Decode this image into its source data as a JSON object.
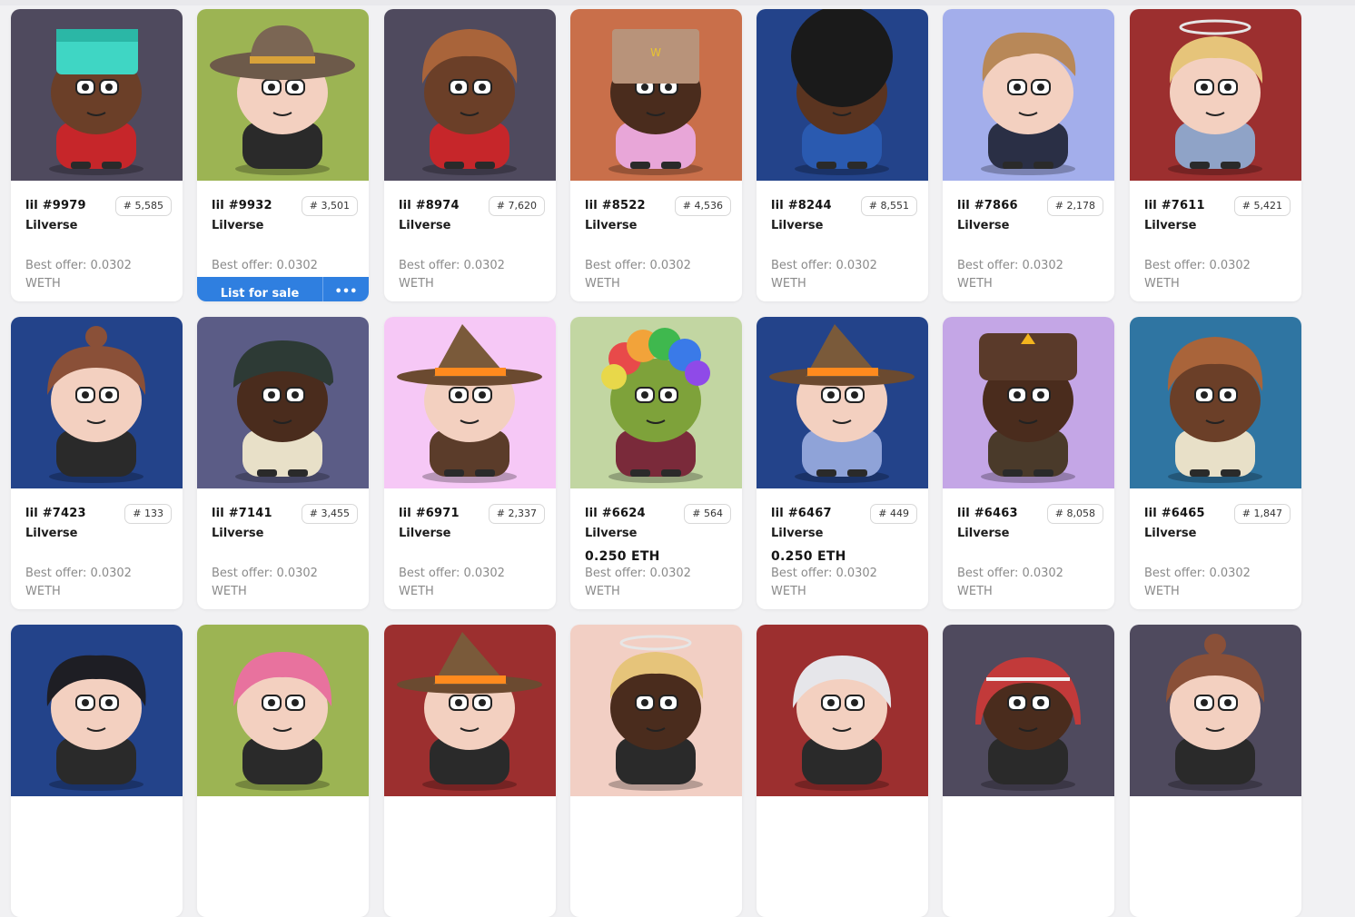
{
  "collection": "Lilverse",
  "offer_text": "Best offer: 0.0302",
  "currency": "WETH",
  "rank_prefix": "#",
  "actions": {
    "list_label": "List for sale",
    "more_label": "•••"
  },
  "cards": [
    {
      "name": "lil #9979",
      "rank": "5,585",
      "bg": "#4f4a5e",
      "skin": "#6b3f28",
      "shirt": "#c6262a",
      "hat": "helmet",
      "price": ""
    },
    {
      "name": "lil #9932",
      "rank": "3,501",
      "bg": "#9cb453",
      "skin": "#f3d0c0",
      "shirt": "#2a2a2a",
      "hat": "sombrero",
      "price": ""
    },
    {
      "name": "lil #8974",
      "rank": "7,620",
      "bg": "#4f4a5e",
      "skin": "#6b3f28",
      "shirt": "#c6262a",
      "hat": "hair-brown",
      "price": ""
    },
    {
      "name": "lil #8522",
      "rank": "4,536",
      "bg": "#c96f4a",
      "skin": "#4a2c1d",
      "shirt": "#e8a6d8",
      "hat": "bag",
      "price": ""
    },
    {
      "name": "lil #8244",
      "rank": "8,551",
      "bg": "#23438a",
      "skin": "#5a3420",
      "shirt": "#2a5ab0",
      "hat": "afro",
      "price": ""
    },
    {
      "name": "lil #7866",
      "rank": "2,178",
      "bg": "#a3aeeb",
      "skin": "#f3d0c0",
      "shirt": "#2a2f45",
      "hat": "hair-light",
      "price": ""
    },
    {
      "name": "lil #7611",
      "rank": "5,421",
      "bg": "#9c2f2f",
      "skin": "#f3d0c0",
      "shirt": "#8fa3c7",
      "hat": "halo",
      "price": ""
    },
    {
      "name": "lil #7423",
      "rank": "133",
      "bg": "#23438a",
      "skin": "#f3d0c0",
      "shirt": "#2a2a2a",
      "hat": "bun",
      "price": ""
    },
    {
      "name": "lil #7141",
      "rank": "3,455",
      "bg": "#5b5c86",
      "skin": "#4a2c1d",
      "shirt": "#e8e0c8",
      "hat": "flatcap",
      "price": ""
    },
    {
      "name": "lil #6971",
      "rank": "2,337",
      "bg": "#f6c8f6",
      "skin": "#f3d0c0",
      "shirt": "#5b3c2a",
      "hat": "witch",
      "price": ""
    },
    {
      "name": "lil #6624",
      "rank": "564",
      "bg": "#c2d6a2",
      "skin": "#7ea23a",
      "shirt": "#7a2a3a",
      "hat": "rainbow",
      "price": "0.250 ETH"
    },
    {
      "name": "lil #6467",
      "rank": "449",
      "bg": "#23438a",
      "skin": "#f3d0c0",
      "shirt": "#8fa3d8",
      "hat": "witch",
      "price": "0.250 ETH"
    },
    {
      "name": "lil #6463",
      "rank": "8,058",
      "bg": "#c4a6e6",
      "skin": "#4a2c1d",
      "shirt": "#4a3a2a",
      "hat": "ushanka",
      "price": ""
    },
    {
      "name": "lil #6465",
      "rank": "1,847",
      "bg": "#2f75a2",
      "skin": "#6b3f28",
      "shirt": "#e8e0c8",
      "hat": "hair-brown",
      "price": ""
    },
    {
      "name": "",
      "rank": "",
      "bg": "#23438a",
      "skin": "#f3d0c0",
      "shirt": "#2a2a2a",
      "hat": "hair-dark",
      "price": ""
    },
    {
      "name": "",
      "rank": "",
      "bg": "#9cb453",
      "skin": "#f3d0c0",
      "shirt": "#2a2a2a",
      "hat": "hair-pink",
      "price": ""
    },
    {
      "name": "",
      "rank": "",
      "bg": "#9c2f2f",
      "skin": "#f3d0c0",
      "shirt": "#2a2a2a",
      "hat": "witch",
      "price": ""
    },
    {
      "name": "",
      "rank": "",
      "bg": "#f2cfc4",
      "skin": "#4a2c1d",
      "shirt": "#2a2a2a",
      "hat": "halo",
      "price": ""
    },
    {
      "name": "",
      "rank": "",
      "bg": "#9c2f2f",
      "skin": "#f3d0c0",
      "shirt": "#2a2a2a",
      "hat": "hair-white",
      "price": ""
    },
    {
      "name": "",
      "rank": "",
      "bg": "#4f4a5e",
      "skin": "#4a2c1d",
      "shirt": "#2a2a2a",
      "hat": "keffiyeh",
      "price": ""
    },
    {
      "name": "",
      "rank": "",
      "bg": "#4f4a5e",
      "skin": "#f3d0c0",
      "shirt": "#2a2a2a",
      "hat": "bun",
      "price": ""
    }
  ]
}
